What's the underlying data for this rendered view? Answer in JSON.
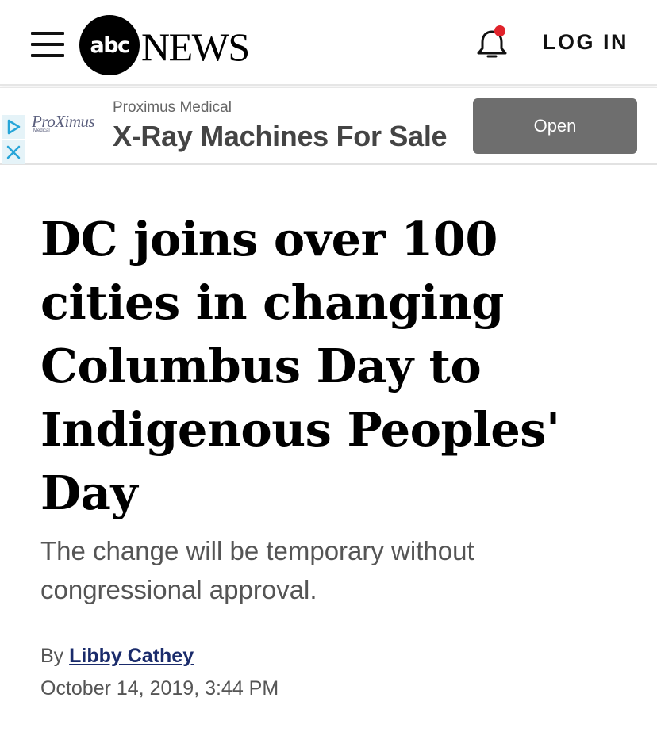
{
  "header": {
    "logo_mark": "abc",
    "logo_word": "NEWS",
    "login_label": "LOG IN",
    "notification_dot_color": "#e0232b"
  },
  "ad": {
    "advertiser_logo": "ProXimus",
    "advertiser_logo_sub": "Medical",
    "sponsor": "Proximus Medical",
    "title": "X-Ray Machines For Sale",
    "cta_label": "Open"
  },
  "article": {
    "headline": "DC joins over 100 cities in changing Columbus Day to Indigenous Peoples' Day",
    "subheadline": "The change will be temporary without congressional approval.",
    "byline_prefix": "By ",
    "author": "Libby Cathey",
    "date": "October 14, 2019, 3:44 PM"
  }
}
